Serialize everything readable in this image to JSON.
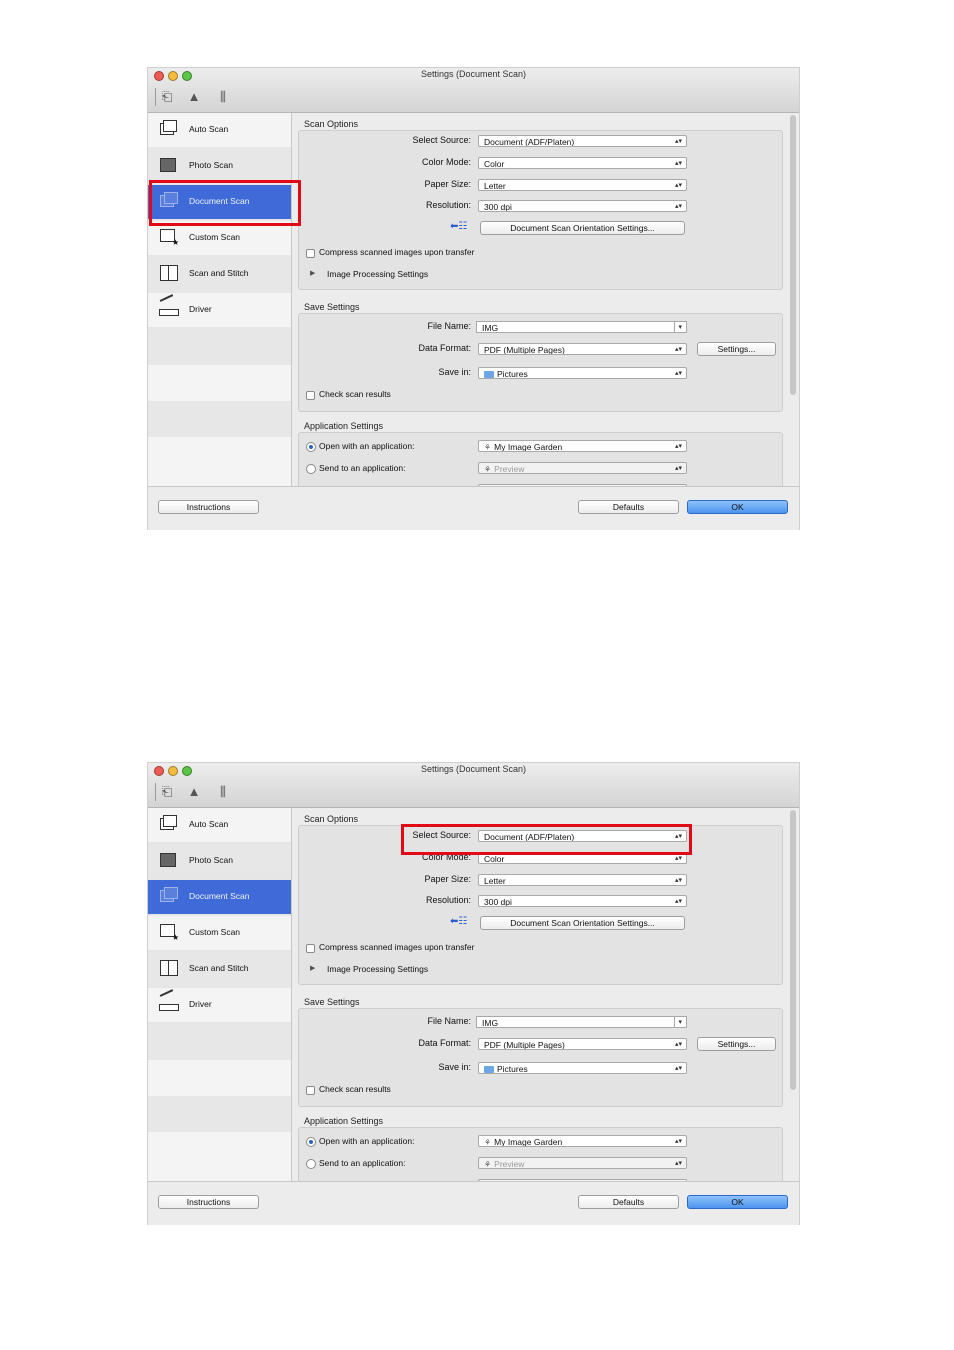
{
  "screens": [
    {
      "window_title": "Settings (Document Scan)",
      "sidebar": [
        {
          "label": "Auto Scan",
          "icon": "auto-scan-icon"
        },
        {
          "label": "Photo Scan",
          "icon": "photo-scan-icon"
        },
        {
          "label": "Document Scan",
          "icon": "document-scan-icon",
          "selected": true
        },
        {
          "label": "Custom Scan",
          "icon": "custom-scan-icon"
        },
        {
          "label": "Scan and Stitch",
          "icon": "scan-and-stitch-icon"
        },
        {
          "label": "Driver",
          "icon": "driver-icon"
        }
      ],
      "scan_options": {
        "title": "Scan Options",
        "select_source_label": "Select Source:",
        "select_source_value": "Document (ADF/Platen)",
        "color_mode_label": "Color Mode:",
        "color_mode_value": "Color",
        "paper_size_label": "Paper Size:",
        "paper_size_value": "Letter",
        "resolution_label": "Resolution:",
        "resolution_value": "300 dpi",
        "orientation_button": "Document Scan Orientation Settings...",
        "compress_label": "Compress scanned images upon transfer",
        "image_processing_label": "Image Processing Settings"
      },
      "save_settings": {
        "title": "Save Settings",
        "file_name_label": "File Name:",
        "file_name_value": "IMG",
        "data_format_label": "Data Format:",
        "data_format_value": "PDF (Multiple Pages)",
        "settings_button": "Settings...",
        "save_in_label": "Save in:",
        "save_in_value": "Pictures",
        "check_results_label": "Check scan results"
      },
      "app_settings": {
        "title": "Application Settings",
        "open_app_label": "Open with an application:",
        "open_app_value": "My Image Garden",
        "send_app_label": "Send to an application:",
        "send_app_value": "Preview"
      },
      "footer": {
        "instructions": "Instructions",
        "defaults": "Defaults",
        "ok": "OK"
      },
      "highlight": "sidebar-document-scan"
    },
    {
      "window_title": "Settings (Document Scan)",
      "sidebar": [
        {
          "label": "Auto Scan",
          "icon": "auto-scan-icon"
        },
        {
          "label": "Photo Scan",
          "icon": "photo-scan-icon"
        },
        {
          "label": "Document Scan",
          "icon": "document-scan-icon",
          "selected": true
        },
        {
          "label": "Custom Scan",
          "icon": "custom-scan-icon"
        },
        {
          "label": "Scan and Stitch",
          "icon": "scan-and-stitch-icon"
        },
        {
          "label": "Driver",
          "icon": "driver-icon"
        }
      ],
      "scan_options": {
        "title": "Scan Options",
        "select_source_label": "Select Source:",
        "select_source_value": "Document (ADF/Platen)",
        "color_mode_label": "Color Mode:",
        "color_mode_value": "Color",
        "paper_size_label": "Paper Size:",
        "paper_size_value": "Letter",
        "resolution_label": "Resolution:",
        "resolution_value": "300 dpi",
        "orientation_button": "Document Scan Orientation Settings...",
        "compress_label": "Compress scanned images upon transfer",
        "image_processing_label": "Image Processing Settings"
      },
      "save_settings": {
        "title": "Save Settings",
        "file_name_label": "File Name:",
        "file_name_value": "IMG",
        "data_format_label": "Data Format:",
        "data_format_value": "PDF (Multiple Pages)",
        "settings_button": "Settings...",
        "save_in_label": "Save in:",
        "save_in_value": "Pictures",
        "check_results_label": "Check scan results"
      },
      "app_settings": {
        "title": "Application Settings",
        "open_app_label": "Open with an application:",
        "open_app_value": "My Image Garden",
        "send_app_label": "Send to an application:",
        "send_app_value": "Preview"
      },
      "footer": {
        "instructions": "Instructions",
        "defaults": "Defaults",
        "ok": "OK"
      },
      "highlight": "select-source-row"
    }
  ],
  "colors": {
    "selected_row": "#3f6ad8",
    "highlight_box": "#e10b17",
    "ok_button": "#4e94ee"
  }
}
